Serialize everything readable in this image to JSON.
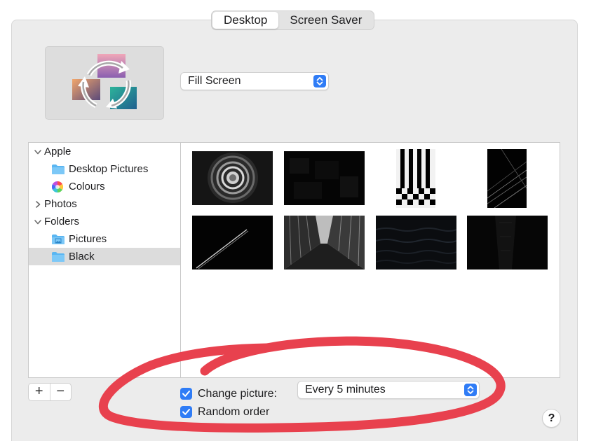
{
  "tabs": [
    {
      "label": "Desktop",
      "active": true
    },
    {
      "label": "Screen Saver",
      "active": false
    }
  ],
  "fit_popup": {
    "value": "Fill Screen"
  },
  "sidebar": {
    "groups": [
      {
        "label": "Apple",
        "expanded": true,
        "items": [
          {
            "label": "Desktop Pictures",
            "icon": "folder-icon"
          },
          {
            "label": "Colours",
            "icon": "color-wheel-icon"
          }
        ]
      },
      {
        "label": "Photos",
        "expanded": false,
        "items": []
      },
      {
        "label": "Folders",
        "expanded": true,
        "items": [
          {
            "label": "Pictures",
            "icon": "pictures-folder-icon"
          },
          {
            "label": "Black",
            "icon": "folder-icon",
            "selected": true
          }
        ]
      }
    ]
  },
  "thumbnails": [
    {
      "name": "spiral-staircase"
    },
    {
      "name": "dark-blocks"
    },
    {
      "name": "striped-checker"
    },
    {
      "name": "radiating-lines"
    },
    {
      "name": "contrail-diagonal"
    },
    {
      "name": "skyscrapers-upward"
    },
    {
      "name": "dark-water"
    },
    {
      "name": "dark-building"
    }
  ],
  "list_buttons": {
    "add": "+",
    "remove": "−"
  },
  "change_picture": {
    "label": "Change picture:",
    "checked": true,
    "interval": "Every 5 minutes"
  },
  "random_order": {
    "label": "Random order",
    "checked": true
  },
  "help_button": {
    "label": "?"
  },
  "colors": {
    "accent": "#2f7cf6",
    "annotation": "#e8414e",
    "folder": "#5ab6f2",
    "selection": "#dcdcdc"
  }
}
